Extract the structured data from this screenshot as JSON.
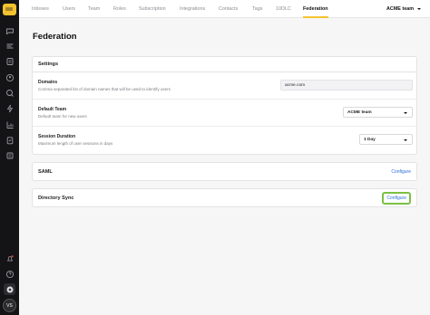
{
  "nav": {
    "tabs": [
      {
        "label": "Inboxes"
      },
      {
        "label": "Users"
      },
      {
        "label": "Team"
      },
      {
        "label": "Roles"
      },
      {
        "label": "Subscription"
      },
      {
        "label": "Integrations"
      },
      {
        "label": "Contacts"
      },
      {
        "label": "Tags"
      },
      {
        "label": "10DLC"
      },
      {
        "label": "Federation"
      }
    ],
    "active_tab": "Federation",
    "team_switcher": "ACME team"
  },
  "page": {
    "title": "Federation"
  },
  "settings": {
    "header": "Settings",
    "rows": [
      {
        "label": "Domains",
        "description": "Comma separated list of domain names that will be used to identify users",
        "value": "acme.com"
      },
      {
        "label": "Default Team",
        "description": "Default team for new users",
        "value": "ACME team"
      },
      {
        "label": "Session Duration",
        "description": "Maximum length of user sessions in days",
        "value": "1 Day"
      }
    ]
  },
  "saml": {
    "title": "SAML",
    "action": "Configure"
  },
  "directory_sync": {
    "title": "Directory Sync",
    "action": "Configure"
  },
  "user": {
    "initials": "VS"
  },
  "colors": {
    "accent": "#f4c22f",
    "link": "#2b6fd6",
    "focus_ring": "#7ac043",
    "sidebar": "#141416"
  },
  "sidebar_icons": [
    "chat-icon",
    "filters-icon",
    "document-icon",
    "contacts-icon",
    "broadcast-icon",
    "bolt-icon",
    "report-icon",
    "clipboard-icon",
    "list-icon",
    "bell-icon",
    "help-icon",
    "settings-icon"
  ]
}
